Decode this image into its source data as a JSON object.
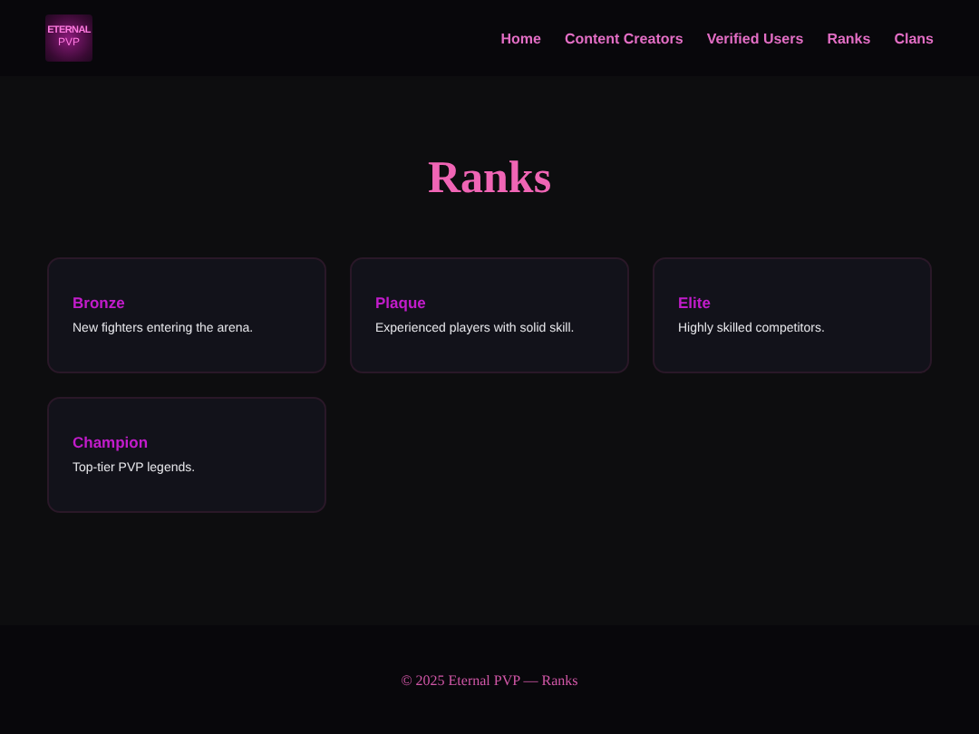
{
  "header": {
    "logo": {
      "lines": [
        "ETERNAL",
        "PVP"
      ]
    },
    "nav": [
      {
        "label": "Home"
      },
      {
        "label": "Content Creators"
      },
      {
        "label": "Verified Users"
      },
      {
        "label": "Ranks"
      },
      {
        "label": "Clans"
      }
    ]
  },
  "page_title": "Ranks",
  "ranks": [
    {
      "name": "Bronze",
      "description": "New fighters entering the arena."
    },
    {
      "name": "Plaque",
      "description": "Experienced players with solid skill."
    },
    {
      "name": "Elite",
      "description": "Highly skilled competitors."
    },
    {
      "name": "Champion",
      "description": "Top-tier PVP legends."
    }
  ],
  "footer": "© 2025 Eternal PVP — Ranks"
}
